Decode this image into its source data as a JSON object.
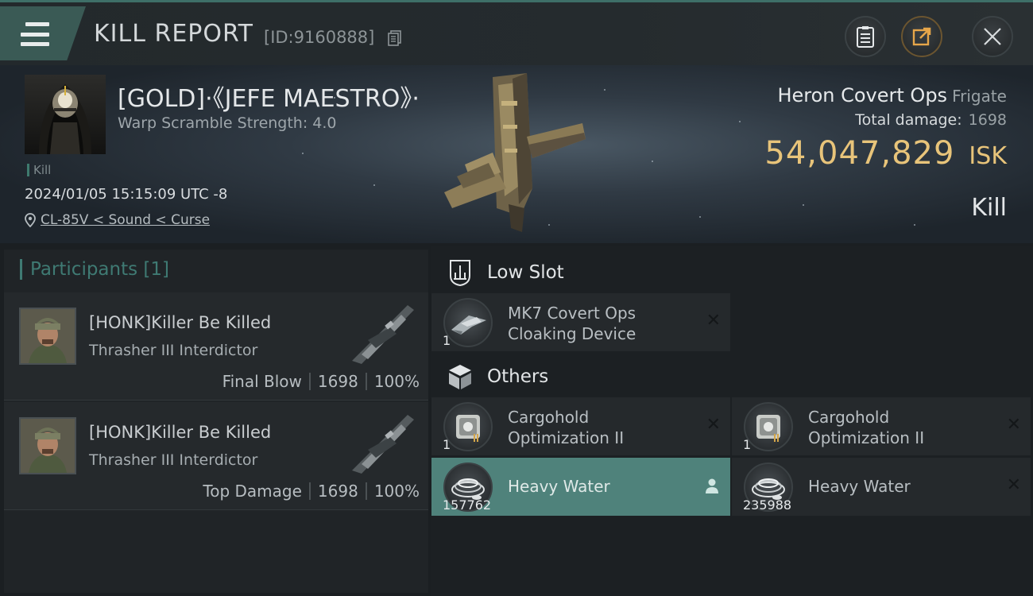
{
  "header": {
    "title": "KILL REPORT",
    "id_label": "[ID:9160888]",
    "accent": "#3e6f68"
  },
  "victim": {
    "name": "[GOLD]·《JEFE MAESTRO》·",
    "warp_scramble": "Warp Scramble Strength: 4.0",
    "kill_tag": "Kill",
    "datetime": "2024/01/05 15:15:09 UTC -8",
    "location": "CL-85V < Sound < Curse",
    "ship_name": "Heron Covert Ops",
    "ship_class": "Frigate",
    "total_damage_label": "Total damage:",
    "total_damage_value": "1698",
    "isk_value": "54,047,829",
    "isk_unit": "ISK",
    "result": "Kill",
    "isk_color": "#e8c47a"
  },
  "participants": {
    "title": "Participants [1]",
    "rows": [
      {
        "name": "[HONK]Killer Be Killed",
        "ship": "Thrasher III Interdictor",
        "role": "Final Blow",
        "damage": "1698",
        "percent": "100%"
      },
      {
        "name": "[HONK]Killer Be Killed",
        "ship": "Thrasher III Interdictor",
        "role": "Top Damage",
        "damage": "1698",
        "percent": "100%"
      }
    ]
  },
  "modules": {
    "low_slot": {
      "label": "Low Slot",
      "items": [
        {
          "qty": "1",
          "name_line1": "MK7 Covert Ops",
          "name_line2": "Cloaking Device",
          "status": "destroyed"
        }
      ]
    },
    "others": {
      "label": "Others",
      "items": [
        {
          "qty": "1",
          "name_line1": "Cargohold",
          "name_line2": "Optimization II",
          "status": "destroyed"
        },
        {
          "qty": "1",
          "name_line1": "Cargohold",
          "name_line2": "Optimization II",
          "status": "destroyed"
        },
        {
          "qty": "157762",
          "name": "Heavy Water",
          "status": "dropped"
        },
        {
          "qty": "235988",
          "name": "Heavy Water",
          "status": "destroyed"
        }
      ]
    },
    "x_glyph": "✕"
  }
}
